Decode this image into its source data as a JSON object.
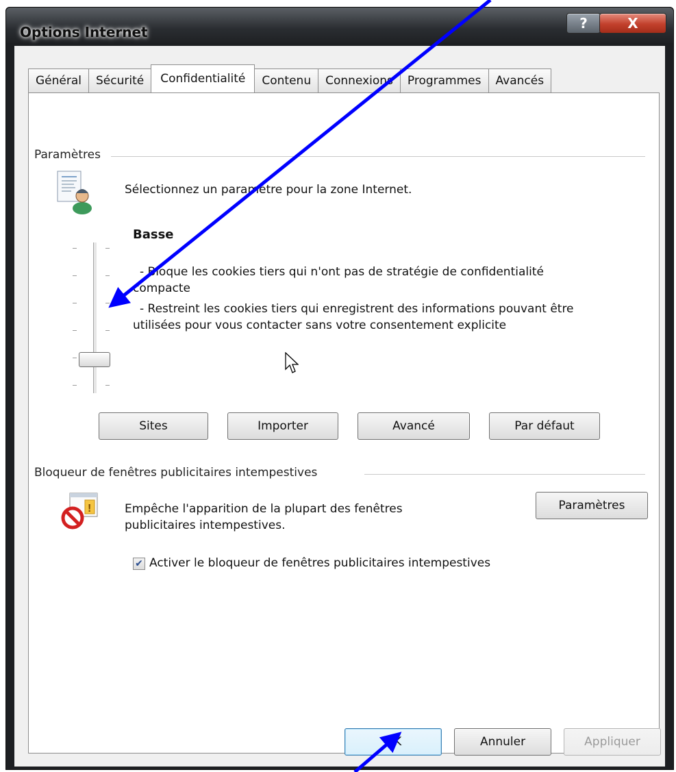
{
  "window": {
    "title": "Options Internet",
    "help_label": "?",
    "close_label": "X"
  },
  "tabs": [
    {
      "label": "Général"
    },
    {
      "label": "Sécurité"
    },
    {
      "label": "Confidentialité",
      "active": true
    },
    {
      "label": "Contenu"
    },
    {
      "label": "Connexions"
    },
    {
      "label": "Programmes"
    },
    {
      "label": "Avancés"
    }
  ],
  "settings": {
    "group_label": "Paramètres",
    "description": "Sélectionnez un paramètre pour la zone Internet.",
    "level_name": "Basse",
    "line1a": "- Bloque les cookies tiers qui n'ont pas de stratégie de confidentialité",
    "line1b": "compacte",
    "line2a": "- Restreint les cookies tiers qui enregistrent des informations pouvant être",
    "line2b": "utilisées pour vous contacter sans votre consentement explicite",
    "slider_level": 2,
    "slider_levels_total": 6,
    "buttons": {
      "sites": "Sites",
      "import": "Importer",
      "advanced": "Avancé",
      "default": "Par défaut"
    }
  },
  "popup": {
    "group_label": "Bloqueur de fenêtres publicitaires intempestives",
    "desc1": "Empêche l'apparition de la plupart des fenêtres",
    "desc2": "publicitaires intempestives.",
    "settings_button": "Paramètres",
    "checkbox_label": "Activer le bloqueur de fenêtres publicitaires intempestives",
    "checkbox_checked": true
  },
  "footer": {
    "ok": "OK",
    "cancel": "Annuler",
    "apply": "Appliquer"
  },
  "colors": {
    "annotation_arrow": "#0000ff",
    "close_button": "#c2402c",
    "focus": "#3c7fb1"
  }
}
